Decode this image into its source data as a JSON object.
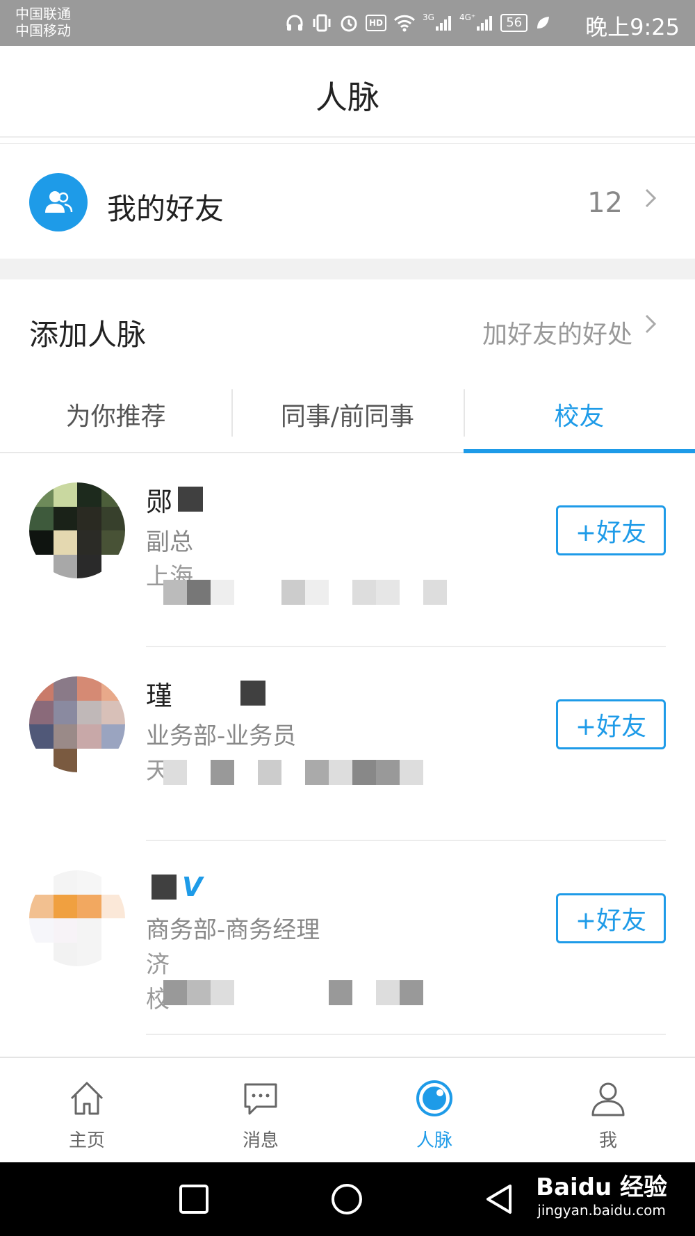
{
  "status_bar": {
    "carrier_1": "中国联通",
    "carrier_2": "中国移动",
    "net_3g": "3G",
    "net_4g": "4G⁺",
    "hd": "HD",
    "battery": "56",
    "time": "晚上9:25"
  },
  "header": {
    "title": "人脉"
  },
  "friends": {
    "label": "我的好友",
    "count": "12"
  },
  "add_connections": {
    "label": "添加人脉",
    "benefit_link": "加好友的好处"
  },
  "tabs": [
    {
      "label": "为你推荐",
      "active": false
    },
    {
      "label": "同事/前同事",
      "active": false
    },
    {
      "label": "校友",
      "active": true
    }
  ],
  "people": [
    {
      "name": "郧",
      "role": "副总",
      "company": "上海",
      "school": "",
      "button": "+好友"
    },
    {
      "name": "瑾",
      "role": "业务部-业务员",
      "company": "天",
      "school": "",
      "button": "+好友"
    },
    {
      "name": "",
      "role": "商务部-商务经理",
      "company": "济",
      "school": "校",
      "button": "+好友",
      "verified_badge": "V"
    }
  ],
  "bottom_nav": [
    {
      "label": "主页",
      "icon": "home-icon",
      "active": false
    },
    {
      "label": "消息",
      "icon": "message-icon",
      "active": false
    },
    {
      "label": "人脉",
      "icon": "connections-icon",
      "active": true
    },
    {
      "label": "我",
      "icon": "profile-icon",
      "active": false
    }
  ],
  "watermark": {
    "main": "Baidu 经验",
    "sub": "jingyan.baidu.com"
  },
  "colors": {
    "accent": "#1e9be8",
    "status_bar": "#9a9a9a"
  }
}
